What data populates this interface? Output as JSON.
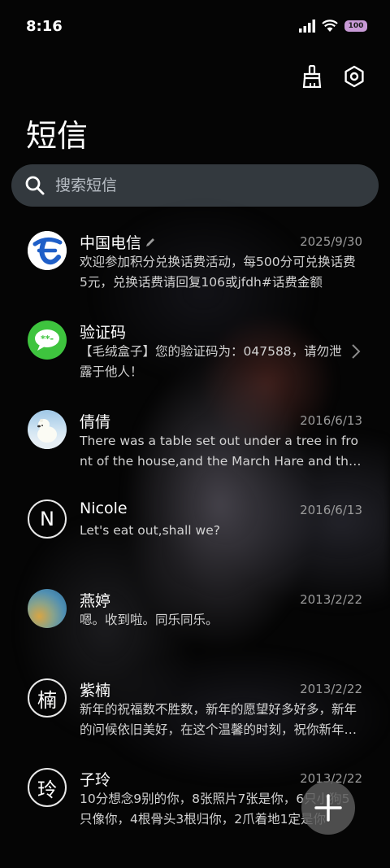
{
  "status_bar": {
    "time": "8:16",
    "battery": "100"
  },
  "header": {
    "title": "短信",
    "clean_icon": "broom-icon",
    "settings_icon": "settings-hex-icon"
  },
  "search": {
    "placeholder": "搜索短信"
  },
  "conversations": [
    {
      "name": "中国电信",
      "date": "2025/9/30",
      "preview": "欢迎参加积分兑换话费活动，每500分可兑换话费5元，兑换话费请回复106或jfdh#话费金额",
      "avatar": "china-telecom-logo"
    },
    {
      "name": "验证码",
      "date": "",
      "preview": "【毛绒盒子】您的验证码为：047588，请勿泄露于他人！",
      "avatar": "message-bubble-icon"
    },
    {
      "name": "倩倩",
      "date": "2016/6/13",
      "preview": "There was a table set out under a tree in front of the house,and the March Hare and the Hatter were having tea",
      "avatar": "polar-bear-photo"
    },
    {
      "name": "Nicole",
      "date": "2016/6/13",
      "preview": "Let's eat out,shall we?",
      "avatar_letter": "N"
    },
    {
      "name": "燕婷",
      "date": "2013/2/22",
      "preview": "嗯。收到啦。同乐同乐。",
      "avatar": "landscape-photo"
    },
    {
      "name": "紫楠",
      "date": "2013/2/22",
      "preview": "新年的祝福数不胜数，新年的愿望好多好多，新年的问候依旧美好，在这个温馨的时刻，祝你新年快乐",
      "avatar_letter": "楠"
    },
    {
      "name": "子玲",
      "date": "2013/2/22",
      "preview": "10分想念9别的你，8张照片7张是你，6只小狗5只像你，4根骨头3根归你，2爪着地1定是你",
      "avatar_letter": "玲"
    }
  ],
  "colors": {
    "background": "#050505",
    "search_bg": "#4a545e",
    "telecom_blue": "#1f5fc8",
    "sms_green": "#3ec43e",
    "battery": "#c89ad6"
  }
}
